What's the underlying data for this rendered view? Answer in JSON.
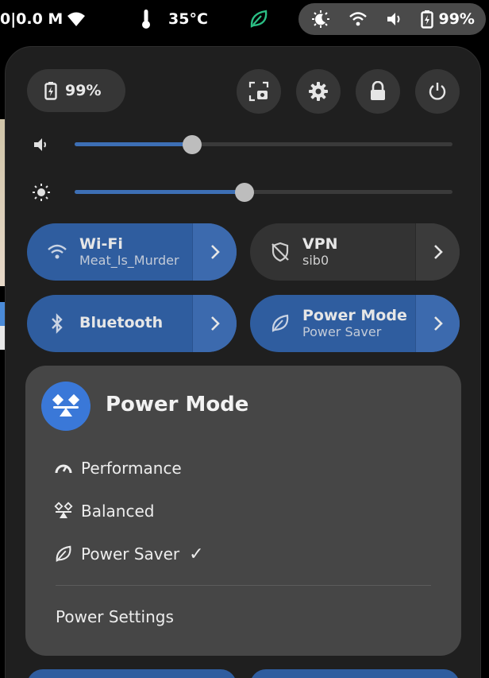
{
  "topbar": {
    "network_speed": "0|0.0 M",
    "temperature": "35°C",
    "status_pill": {
      "battery": "99%"
    }
  },
  "panel": {
    "battery_pill": "99%",
    "buttons": [
      "screenshot",
      "settings",
      "lock",
      "power"
    ],
    "sliders": {
      "volume": {
        "level": 0.31
      },
      "brightness": {
        "level": 0.45
      }
    },
    "toggles": {
      "wifi": {
        "title": "Wi-Fi",
        "subtitle": "Meat_Is_Murder"
      },
      "vpn": {
        "title": "VPN",
        "subtitle": "sib0"
      },
      "bluetooth": {
        "title": "Bluetooth"
      },
      "power_mode": {
        "title": "Power Mode",
        "subtitle": "Power Saver"
      }
    }
  },
  "submenu": {
    "title": "Power Mode",
    "items": [
      "Performance",
      "Balanced",
      "Power Saver"
    ],
    "checked": "Power Saver",
    "checkmark": "✓",
    "settings": "Power Settings"
  },
  "colors": {
    "accent": "#2f5d9f",
    "accent_bright": "#3a78d8",
    "panel": "#1f1f1f",
    "submenu": "#464646",
    "leaf_green": "#2bbf85"
  },
  "icons": {
    "topbar": [
      "wifi-icon",
      "thermometer-icon",
      "leaf-icon",
      "night-light-icon",
      "volume-icon",
      "battery-charging-icon"
    ],
    "toggles": [
      "wifi-icon",
      "vpn-off-icon",
      "bluetooth-icon",
      "power-saver-icon",
      "chevron-right-icon"
    ],
    "submenu": [
      "power-mode-icon",
      "performance-icon",
      "balanced-icon",
      "power-saver-icon"
    ]
  }
}
